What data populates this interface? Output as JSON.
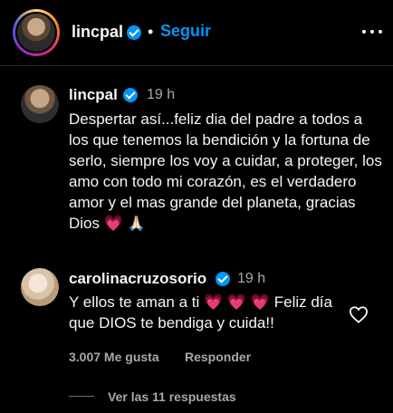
{
  "header": {
    "username": "lincpal",
    "separator": "•",
    "follow_label": "Seguir",
    "more_icon": "more-horizontal-icon"
  },
  "caption": {
    "username": "lincpal",
    "time": "19 h",
    "text": "Despertar así...feliz dia del padre a todos a los que tenemos la bendición y la fortuna de serlo, siempre los voy a cuidar, a proteger, los amo con todo mi corazón, es el verdadero amor y el mas grande del planeta, gracias Dios",
    "emojis": [
      "💗",
      "🙏🏻"
    ]
  },
  "comment": {
    "username": "carolinacruzosorio",
    "time": "19 h",
    "text_before": "Y ellos te aman a ti",
    "hearts": [
      "💗",
      "💗",
      "💗"
    ],
    "text_after": "Feliz día que DIOS te bendiga y cuida!!",
    "likes_label": "3.007 Me gusta",
    "reply_label": "Responder",
    "view_replies_label": "Ver las 11 respuestas"
  },
  "colors": {
    "background": "#000000",
    "accent": "#0095f6",
    "secondary_text": "#a8a8a8"
  }
}
